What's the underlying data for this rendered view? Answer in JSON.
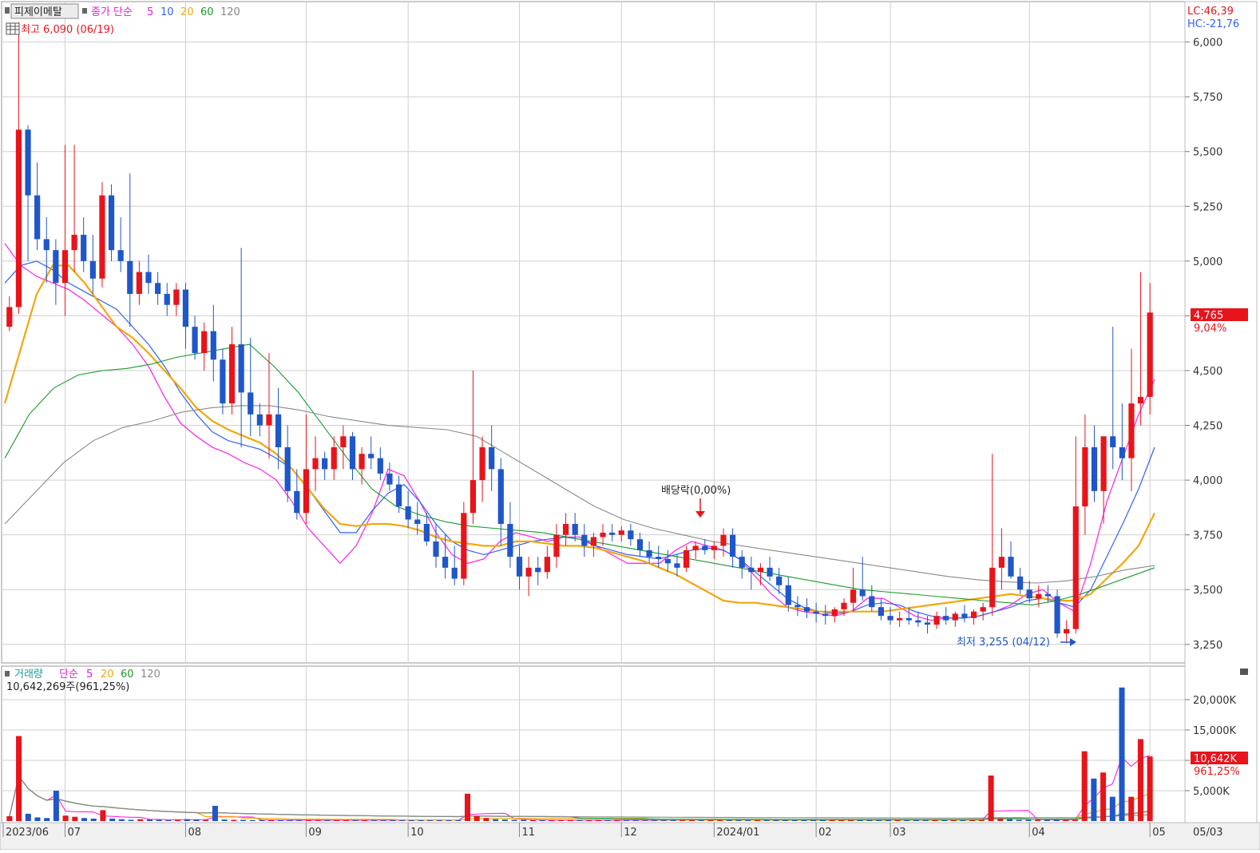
{
  "price_legend": {
    "stock_name": "피제이메탈",
    "indicator": "종가 단순",
    "ma_periods": [
      "5",
      "10",
      "20",
      "60",
      "120"
    ],
    "high_text": "최고 6,090 (06/19)",
    "lc_text": "LC:46,39",
    "hc_text": "HC:-21,76"
  },
  "volume_legend": {
    "title": "거래량",
    "indicator": "단순",
    "ma_periods": [
      "5",
      "20",
      "60",
      "120"
    ],
    "current_text": "10,642,269주(961,25%)"
  },
  "annotations": {
    "dividend_label": "배당락(0,00%)",
    "low_label": "최저 3,255 (04/12)"
  },
  "current_price_tag": {
    "price": "4,765",
    "change": "9,04%"
  },
  "current_volume_tag": {
    "volume": "10,642K",
    "change": "961,25%"
  },
  "colors": {
    "up": "#e8141b",
    "down": "#1f56c9",
    "ma5": "#ff2ee6",
    "ma10": "#3060ff",
    "ma20": "#f2a70c",
    "ma60": "#1a9b2a",
    "ma120": "#8a8a8a",
    "grid": "#cfcfcf",
    "axis_text": "#333333"
  },
  "chart_data": [
    {
      "type": "candlestick",
      "title": "피제이메탈",
      "x_ticks": [
        "2023/06",
        "07",
        "08",
        "09",
        "10",
        "11",
        "12",
        "2024/01",
        "02",
        "03",
        "04",
        "05",
        "05/03"
      ],
      "y_ticks": [
        "6,000",
        "5,750",
        "5,500",
        "5,250",
        "5,000",
        "4,750",
        "4,500",
        "4,250",
        "4,000",
        "3,750",
        "3,500",
        "3,250"
      ],
      "ylim": [
        3180,
        6170
      ],
      "series_names": [
        "종가 단순 5",
        "10",
        "20",
        "60",
        "120"
      ],
      "candles": [
        [
          4700,
          4840,
          4680,
          4790
        ],
        [
          4790,
          6090,
          4760,
          5600
        ],
        [
          5600,
          5620,
          5000,
          5300
        ],
        [
          5300,
          5450,
          5050,
          5100
        ],
        [
          5100,
          5200,
          4900,
          5050
        ],
        [
          5050,
          5100,
          4800,
          4900
        ],
        [
          4900,
          5530,
          4750,
          5050
        ],
        [
          5050,
          5530,
          4950,
          5120
        ],
        [
          5120,
          5200,
          4950,
          5000
        ],
        [
          5000,
          5120,
          4850,
          4920
        ],
        [
          4920,
          5360,
          4880,
          5300
        ],
        [
          5300,
          5350,
          5000,
          5050
        ],
        [
          5050,
          5200,
          4950,
          5000
        ],
        [
          5000,
          5400,
          4700,
          4850
        ],
        [
          4850,
          5000,
          4800,
          4950
        ],
        [
          4950,
          5030,
          4850,
          4900
        ],
        [
          4900,
          4950,
          4800,
          4850
        ],
        [
          4850,
          4900,
          4750,
          4800
        ],
        [
          4800,
          4900,
          4750,
          4870
        ],
        [
          4870,
          4900,
          4600,
          4700
        ],
        [
          4700,
          4750,
          4550,
          4580
        ],
        [
          4580,
          4720,
          4500,
          4680
        ],
        [
          4680,
          4800,
          4450,
          4550
        ],
        [
          4550,
          4600,
          4300,
          4350
        ],
        [
          4350,
          4700,
          4300,
          4620
        ],
        [
          4620,
          5060,
          4150,
          4400
        ],
        [
          4400,
          4650,
          4200,
          4300
        ],
        [
          4300,
          4350,
          4200,
          4250
        ],
        [
          4250,
          4580,
          4100,
          4300
        ],
        [
          4300,
          4420,
          4050,
          4150
        ],
        [
          4150,
          4250,
          3900,
          3950
        ],
        [
          3950,
          4050,
          3820,
          3850
        ],
        [
          3850,
          4300,
          3800,
          4050
        ],
        [
          4050,
          4200,
          3950,
          4100
        ],
        [
          4100,
          4130,
          4000,
          4050
        ],
        [
          4050,
          4200,
          4000,
          4150
        ],
        [
          4150,
          4250,
          4050,
          4200
        ],
        [
          4200,
          4220,
          4000,
          4050
        ],
        [
          4050,
          4150,
          3980,
          4120
        ],
        [
          4120,
          4200,
          4050,
          4100
        ],
        [
          4100,
          4150,
          4000,
          4030
        ],
        [
          4030,
          4080,
          3950,
          3980
        ],
        [
          3980,
          4020,
          3850,
          3880
        ],
        [
          3880,
          3950,
          3780,
          3820
        ],
        [
          3820,
          3900,
          3750,
          3800
        ],
        [
          3800,
          3850,
          3700,
          3720
        ],
        [
          3720,
          3800,
          3600,
          3650
        ],
        [
          3650,
          3750,
          3550,
          3600
        ],
        [
          3600,
          3700,
          3520,
          3550
        ],
        [
          3550,
          3900,
          3520,
          3850
        ],
        [
          3850,
          4500,
          3800,
          4000
        ],
        [
          4000,
          4200,
          3900,
          4150
        ],
        [
          4150,
          4250,
          3950,
          4050
        ],
        [
          4050,
          4100,
          3700,
          3800
        ],
        [
          3800,
          3900,
          3600,
          3650
        ],
        [
          3650,
          3700,
          3500,
          3560
        ],
        [
          3560,
          3650,
          3470,
          3600
        ],
        [
          3600,
          3650,
          3520,
          3580
        ],
        [
          3580,
          3700,
          3550,
          3650
        ],
        [
          3650,
          3800,
          3600,
          3750
        ],
        [
          3750,
          3850,
          3700,
          3800
        ],
        [
          3800,
          3850,
          3720,
          3750
        ],
        [
          3750,
          3800,
          3650,
          3700
        ],
        [
          3700,
          3760,
          3650,
          3740
        ],
        [
          3740,
          3800,
          3700,
          3760
        ],
        [
          3760,
          3800,
          3720,
          3750
        ],
        [
          3750,
          3790,
          3720,
          3770
        ],
        [
          3770,
          3800,
          3700,
          3730
        ],
        [
          3730,
          3760,
          3650,
          3680
        ],
        [
          3680,
          3720,
          3620,
          3650
        ],
        [
          3650,
          3700,
          3600,
          3640
        ],
        [
          3640,
          3680,
          3580,
          3620
        ],
        [
          3620,
          3660,
          3560,
          3600
        ],
        [
          3600,
          3700,
          3580,
          3680
        ],
        [
          3680,
          3720,
          3640,
          3700
        ],
        [
          3700,
          3730,
          3660,
          3680
        ],
        [
          3680,
          3720,
          3640,
          3700
        ],
        [
          3700,
          3780,
          3650,
          3750
        ],
        [
          3750,
          3780,
          3600,
          3650
        ],
        [
          3650,
          3680,
          3550,
          3600
        ],
        [
          3600,
          3650,
          3500,
          3580
        ],
        [
          3580,
          3620,
          3520,
          3600
        ],
        [
          3600,
          3650,
          3540,
          3560
        ],
        [
          3560,
          3600,
          3480,
          3520
        ],
        [
          3520,
          3560,
          3400,
          3430
        ],
        [
          3430,
          3470,
          3380,
          3420
        ],
        [
          3420,
          3460,
          3370,
          3400
        ],
        [
          3400,
          3440,
          3350,
          3390
        ],
        [
          3390,
          3430,
          3340,
          3380
        ],
        [
          3380,
          3420,
          3350,
          3410
        ],
        [
          3410,
          3460,
          3380,
          3440
        ],
        [
          3440,
          3600,
          3400,
          3500
        ],
        [
          3500,
          3650,
          3450,
          3470
        ],
        [
          3470,
          3520,
          3400,
          3420
        ],
        [
          3420,
          3460,
          3360,
          3380
        ],
        [
          3380,
          3420,
          3340,
          3360
        ],
        [
          3360,
          3400,
          3330,
          3370
        ],
        [
          3370,
          3420,
          3340,
          3360
        ],
        [
          3360,
          3400,
          3330,
          3350
        ],
        [
          3350,
          3380,
          3300,
          3340
        ],
        [
          3340,
          3400,
          3320,
          3380
        ],
        [
          3380,
          3420,
          3340,
          3360
        ],
        [
          3360,
          3400,
          3330,
          3390
        ],
        [
          3390,
          3430,
          3350,
          3370
        ],
        [
          3370,
          3410,
          3340,
          3400
        ],
        [
          3400,
          3440,
          3360,
          3420
        ],
        [
          3420,
          4120,
          3380,
          3600
        ],
        [
          3600,
          3780,
          3500,
          3650
        ],
        [
          3650,
          3720,
          3550,
          3560
        ],
        [
          3560,
          3600,
          3480,
          3500
        ],
        [
          3500,
          3540,
          3440,
          3460
        ],
        [
          3460,
          3520,
          3420,
          3480
        ],
        [
          3480,
          3520,
          3440,
          3470
        ],
        [
          3470,
          3500,
          3280,
          3300
        ],
        [
          3300,
          3360,
          3255,
          3320
        ],
        [
          3320,
          4200,
          3300,
          3880
        ],
        [
          3880,
          4300,
          3750,
          4150
        ],
        [
          4150,
          4250,
          3900,
          3950
        ],
        [
          3950,
          4100,
          3800,
          4200
        ],
        [
          4200,
          4700,
          4050,
          4150
        ],
        [
          4150,
          4350,
          4000,
          4100
        ],
        [
          4100,
          4600,
          3950,
          4350
        ],
        [
          4350,
          4950,
          4250,
          4380
        ],
        [
          4380,
          4900,
          4300,
          4765
        ]
      ],
      "ma_lines": {
        "ma5": [
          5080,
          4980,
          4930,
          4900,
          4870,
          4820,
          4760,
          4700,
          4620,
          4520,
          4380,
          4260,
          4200,
          4150,
          4120,
          4080,
          4050,
          4000,
          3900,
          3780,
          3700,
          3620,
          3700,
          3850,
          4050,
          4020,
          3900,
          3760,
          3660,
          3620,
          3640,
          3720,
          3760,
          3740,
          3720,
          3740,
          3740,
          3700,
          3660,
          3620,
          3620,
          3620,
          3680,
          3720,
          3700,
          3680,
          3640,
          3560,
          3480,
          3420,
          3400,
          3390,
          3380,
          3400,
          3460,
          3460,
          3420,
          3380,
          3360,
          3370,
          3370,
          3380,
          3400,
          3430,
          3480,
          3500,
          3440,
          3400,
          3620,
          3900,
          4100,
          4300,
          4460
        ],
        "ma10": [
          4900,
          4980,
          5000,
          4960,
          4900,
          4860,
          4820,
          4780,
          4700,
          4620,
          4520,
          4400,
          4300,
          4220,
          4180,
          4160,
          4140,
          4100,
          4050,
          3960,
          3860,
          3760,
          3760,
          3860,
          3940,
          3980,
          3900,
          3800,
          3720,
          3680,
          3660,
          3680,
          3700,
          3720,
          3730,
          3740,
          3730,
          3700,
          3680,
          3660,
          3650,
          3640,
          3660,
          3680,
          3690,
          3680,
          3640,
          3580,
          3520,
          3460,
          3420,
          3400,
          3390,
          3400,
          3430,
          3440,
          3430,
          3400,
          3380,
          3370,
          3370,
          3380,
          3400,
          3420,
          3450,
          3460,
          3440,
          3420,
          3500,
          3650,
          3800,
          3960,
          4150
        ],
        "ma20": [
          4350,
          4600,
          4850,
          4980,
          4980,
          4900,
          4800,
          4700,
          4650,
          4580,
          4500,
          4420,
          4330,
          4270,
          4230,
          4200,
          4170,
          4120,
          4050,
          3960,
          3870,
          3800,
          3790,
          3800,
          3800,
          3790,
          3770,
          3740,
          3720,
          3710,
          3700,
          3700,
          3720,
          3720,
          3710,
          3700,
          3700,
          3690,
          3670,
          3650,
          3630,
          3600,
          3570,
          3530,
          3490,
          3450,
          3440,
          3440,
          3430,
          3420,
          3410,
          3400,
          3400,
          3400,
          3400,
          3400,
          3410,
          3420,
          3430,
          3440,
          3450,
          3460,
          3470,
          3480,
          3470,
          3460,
          3450,
          3450,
          3480,
          3550,
          3620,
          3700,
          3850
        ],
        "ma60": [
          4100,
          4300,
          4420,
          4480,
          4500,
          4510,
          4530,
          4560,
          4580,
          4600,
          4620,
          4520,
          4400,
          4250,
          4100,
          3960,
          3880,
          3840,
          3810,
          3790,
          3780,
          3770,
          3760,
          3740,
          3720,
          3700,
          3680,
          3660,
          3640,
          3620,
          3600,
          3580,
          3560,
          3540,
          3520,
          3500,
          3490,
          3480,
          3470,
          3460,
          3450,
          3440,
          3430,
          3450,
          3480,
          3520,
          3560,
          3600
        ],
        "ma120": [
          3800,
          3940,
          4080,
          4180,
          4240,
          4270,
          4310,
          4330,
          4340,
          4340,
          4320,
          4290,
          4270,
          4250,
          4240,
          4230,
          4200,
          4120,
          4040,
          3960,
          3880,
          3820,
          3780,
          3750,
          3720,
          3700,
          3680,
          3660,
          3640,
          3620,
          3600,
          3580,
          3560,
          3545,
          3535,
          3530,
          3540,
          3560,
          3590,
          3610
        ]
      }
    },
    {
      "type": "bar",
      "title": "거래량",
      "y_ticks": [
        "20,000K",
        "15,000K",
        "10,000K",
        "5,000K"
      ],
      "ylim": [
        0,
        25000
      ],
      "series_names": [
        "단순 5",
        "20",
        "60",
        "120"
      ],
      "values": [
        800,
        14000,
        1200,
        600,
        500,
        5000,
        900,
        700,
        500,
        400,
        1800,
        400,
        300,
        200,
        300,
        250,
        200,
        150,
        200,
        300,
        250,
        200,
        2500,
        250,
        200,
        200,
        150,
        150,
        150,
        150,
        150,
        150,
        150,
        150,
        150,
        150,
        150,
        150,
        150,
        150,
        150,
        150,
        150,
        150,
        150,
        150,
        150,
        150,
        150,
        4500,
        800,
        500,
        300,
        250,
        200,
        200,
        150,
        150,
        150,
        150,
        150,
        150,
        150,
        150,
        150,
        150,
        150,
        150,
        150,
        150,
        150,
        150,
        150,
        150,
        150,
        150,
        150,
        150,
        150,
        150,
        150,
        150,
        150,
        150,
        150,
        150,
        150,
        150,
        150,
        150,
        150,
        150,
        150,
        150,
        150,
        150,
        150,
        150,
        150,
        150,
        150,
        150,
        150,
        150,
        150,
        7500,
        400,
        300,
        200,
        200,
        200,
        200,
        200,
        200,
        200,
        11500,
        7000,
        8000,
        4000,
        22000,
        4000,
        13500,
        10642
      ]
    }
  ]
}
